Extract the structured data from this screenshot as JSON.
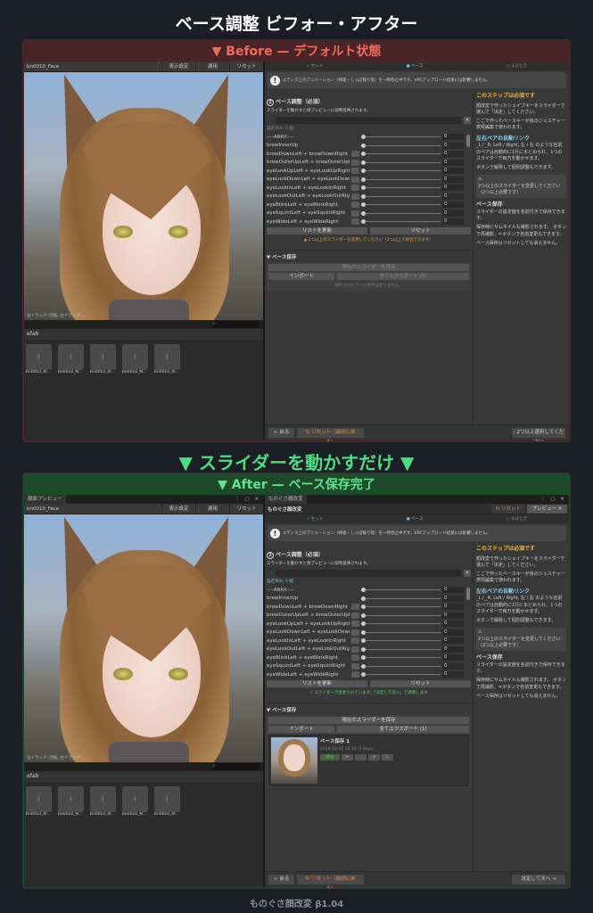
{
  "title": "ベース調整 ビフォー・アフター",
  "middle_caption": "▼ スライダーを動かすだけ ▼",
  "footer": "ものぐさ顔改変 β1.04",
  "sliders": [
    {
      "name": "----ARKit----",
      "linked": false,
      "value": "0"
    },
    {
      "name": "browInnerUp",
      "linked": false,
      "value": "0"
    },
    {
      "name": "browDownLeft + browDownRight",
      "linked": true,
      "value": "0"
    },
    {
      "name": "browOuterUpLeft + browOuterUpRight",
      "linked": true,
      "value": "0"
    },
    {
      "name": "eyeLookUpLeft + eyeLookUpRight",
      "linked": true,
      "value": "0"
    },
    {
      "name": "eyeLookDownLeft + eyeLookDownRight",
      "linked": true,
      "value": "0"
    },
    {
      "name": "eyeLookInLeft + eyeLookInRight",
      "linked": true,
      "value": "0"
    },
    {
      "name": "eyeLookOutLeft + eyeLookOutRight",
      "linked": true,
      "value": "0"
    },
    {
      "name": "eyeBlinkLeft + eyeBlinkRight",
      "linked": true,
      "value": "0"
    },
    {
      "name": "eyeSquintLeft + eyeSquintRight",
      "linked": true,
      "value": "0"
    },
    {
      "name": "eyeWideLeft + eyeWideRight",
      "linked": true,
      "value": "0"
    }
  ],
  "side": {
    "title": "このステップは必須です",
    "p1": "顔改変で作ったシェイプキーをスライダーで選んで「決定」してください。",
    "p2": "ここで作ったベースキーが後のジェスチャー表情編集で使われます。",
    "h2": "左右ペアの自動リンク",
    "p3": "_L / _R, Left / Right, 左 / 右 のような名前のペアは自動的に1行にまとめられ、1つのスライダーで両方を動かせます。",
    "p4": "ボタンで解除して個別調整もできます。",
    "warn_icon": "⚠",
    "warn": "2つ以上のスライダーを変更してください（2つ以上必要です）",
    "h3": "ベース保存",
    "p5": "スライダーの設定値を名前付きで保存できます。",
    "p6": "保存時にサムネイルも撮影されます。 ボタンで再撮影、✏ボタンで名前変更もできます。",
    "p7": "ベース保存はリセットしても消えません。"
  },
  "before": {
    "band": "▼ Before — デフォルト状態",
    "object": "bn0010_Face",
    "tool_buttons": [
      "表示設定",
      "適用",
      "リセット"
    ],
    "hint": "右ドラッグ: 回転, 左ドラッグ: ...",
    "project": "efab",
    "thumbs": [
      "bn0010_M...",
      "bn0010_M...",
      "bn0010_M...",
      "bn0010_M...",
      "bn0010_M..."
    ],
    "steps": [
      "✓ セット",
      "● ベース",
      "○ まばたき"
    ],
    "info": "エディタ上のアニメーション（呼吸・しっぽ振り等）を一時停止中です。VRCアップロード結果には影響しません。",
    "step_no": "2",
    "heading": "ベース調整（必須）",
    "desc": "スライダーを動かすと顔プレビューに即時反映されます。",
    "count": "設定済み: 0 個",
    "refresh": "リストを更新",
    "reset_list": "リセット",
    "status": "▲ 2つ以上のスライダーを変更してください（2つ以上で統合できます）",
    "section": "▼ ベース保存",
    "save": "現在のスライダーを保存",
    "import": "インポート",
    "export": "全てエクスポート (0)",
    "empty": "保存されたベース保存はありません。",
    "back": "← 戻る",
    "reset_all": "↻ リセット（最初に戻る）",
    "next": "- 2つ以上選択してください"
  },
  "after": {
    "band": "▼ After — ベース保存完了",
    "tab_left": "顔面プレビュー",
    "tab_right": "ものぐさ顔改変",
    "window_buttons": "⋮ ▢ ✕",
    "app_title": "ものぐさ顔改変",
    "app_reset": "↻ リセット",
    "app_preview": "プレビュー ✕",
    "object": "bn0010_Face",
    "tool_buttons": [
      "表示設定",
      "適用",
      "リセット"
    ],
    "hint": "右ドラッグ: 回転, 左ドラッグ: ...",
    "project": "efab",
    "thumbs": [
      "bn0010_M...",
      "bn0010_M...",
      "bn0010_M...",
      "bn0010_M...",
      "bn0010_M..."
    ],
    "steps": [
      "✓ セット",
      "● ベース",
      "○ まばたき"
    ],
    "info": "エディタ上のアニメーション（呼吸・しっぽ振り等）を一時停止中です。VRCアップロード結果には影響しません。",
    "step_no": "2",
    "heading": "ベース調整（必須）",
    "desc": "スライダーを動かすと顔プレビューに即時反映されます。",
    "count": "設定済み: 5 個",
    "refresh": "リストを更新",
    "reset_list": "リセット",
    "status": "✓ スライダーが変更されています。「決定して次へ」で適用します",
    "section": "▼ ベース保存",
    "save": "現在のスライダーを保存",
    "import": "インポート",
    "export": "全てエクスポート (1)",
    "saved": {
      "name": "ベース保存 1",
      "meta": "2026-03-22 16:13  (5 keys)",
      "load": "読込",
      "rename": "✏",
      "retake": "",
      "export": "↗",
      "delete": "✕"
    },
    "back": "← 戻る",
    "reset_all": "↻ リセット（最初に戻る）",
    "next": "決定して次へ →"
  }
}
